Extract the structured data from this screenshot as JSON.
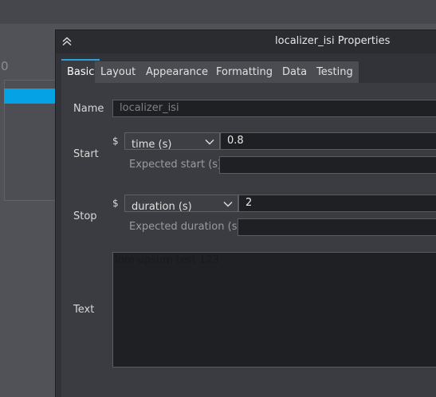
{
  "background": {
    "axis_zero": "0"
  },
  "dialog": {
    "title": "localizer_isi Properties",
    "tabs": [
      {
        "label": "Basic"
      },
      {
        "label": "Layout"
      },
      {
        "label": "Appearance"
      },
      {
        "label": "Formatting"
      },
      {
        "label": "Data"
      },
      {
        "label": "Testing"
      }
    ],
    "active_tab": "Basic",
    "name": {
      "label": "Name",
      "value": "localizer_isi"
    },
    "start": {
      "label": "Start",
      "dollar": "$",
      "type": "time (s)",
      "value": "0.8",
      "expected_label": "Expected start (s)",
      "expected_value": ""
    },
    "stop": {
      "label": "Stop",
      "dollar": "$",
      "type": "duration (s)",
      "value": "2",
      "expected_label": "Expected duration (s)",
      "expected_value": ""
    },
    "text": {
      "label": "Text",
      "value": "lore upsum test 123"
    }
  },
  "colors": {
    "accent": "#2aa0d8",
    "background_bar": "#05a2e6"
  }
}
